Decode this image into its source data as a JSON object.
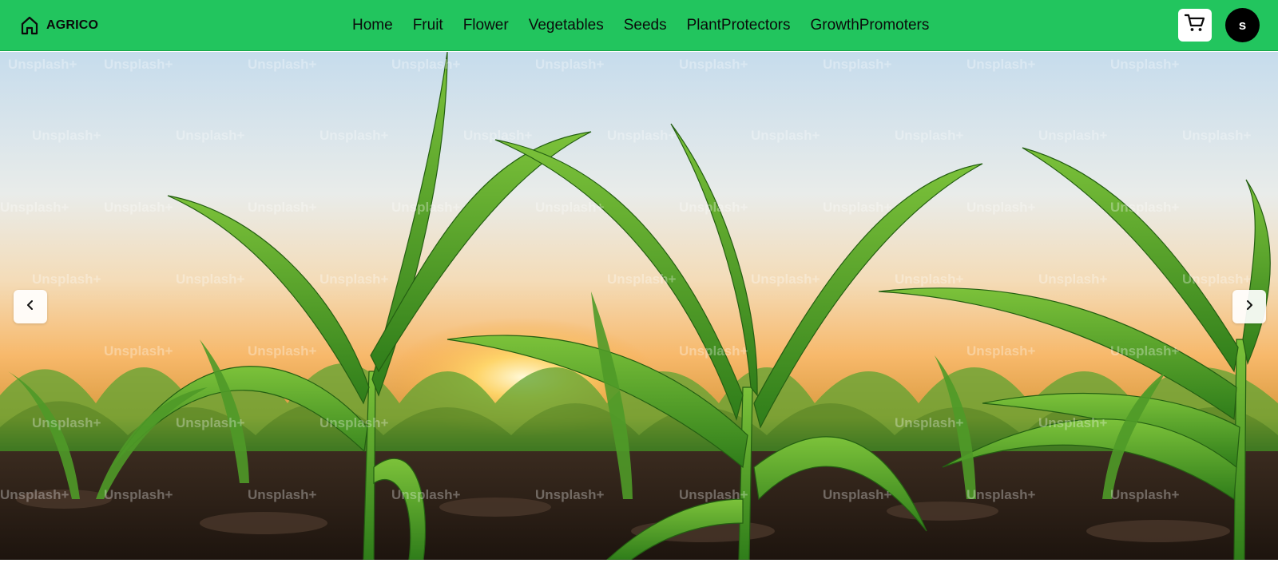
{
  "brand": {
    "name": "AGRICO",
    "icon": "home-icon"
  },
  "nav": {
    "items": [
      {
        "label": "Home"
      },
      {
        "label": "Fruit"
      },
      {
        "label": "Flower"
      },
      {
        "label": "Vegetables"
      },
      {
        "label": "Seeds"
      },
      {
        "label": "PlantProtectors"
      },
      {
        "label": "GrowthPromoters"
      }
    ]
  },
  "header_actions": {
    "cart_icon": "cart-icon",
    "avatar_initial": "s"
  },
  "hero": {
    "image_subject": "corn seedlings in a field at sunset",
    "watermark_text": "Unsplash+",
    "prev_icon": "chevron-left-icon",
    "next_icon": "chevron-right-icon"
  },
  "colors": {
    "navbar_bg": "#22c55e",
    "avatar_bg": "#000000",
    "cart_bg": "#ffffff"
  }
}
